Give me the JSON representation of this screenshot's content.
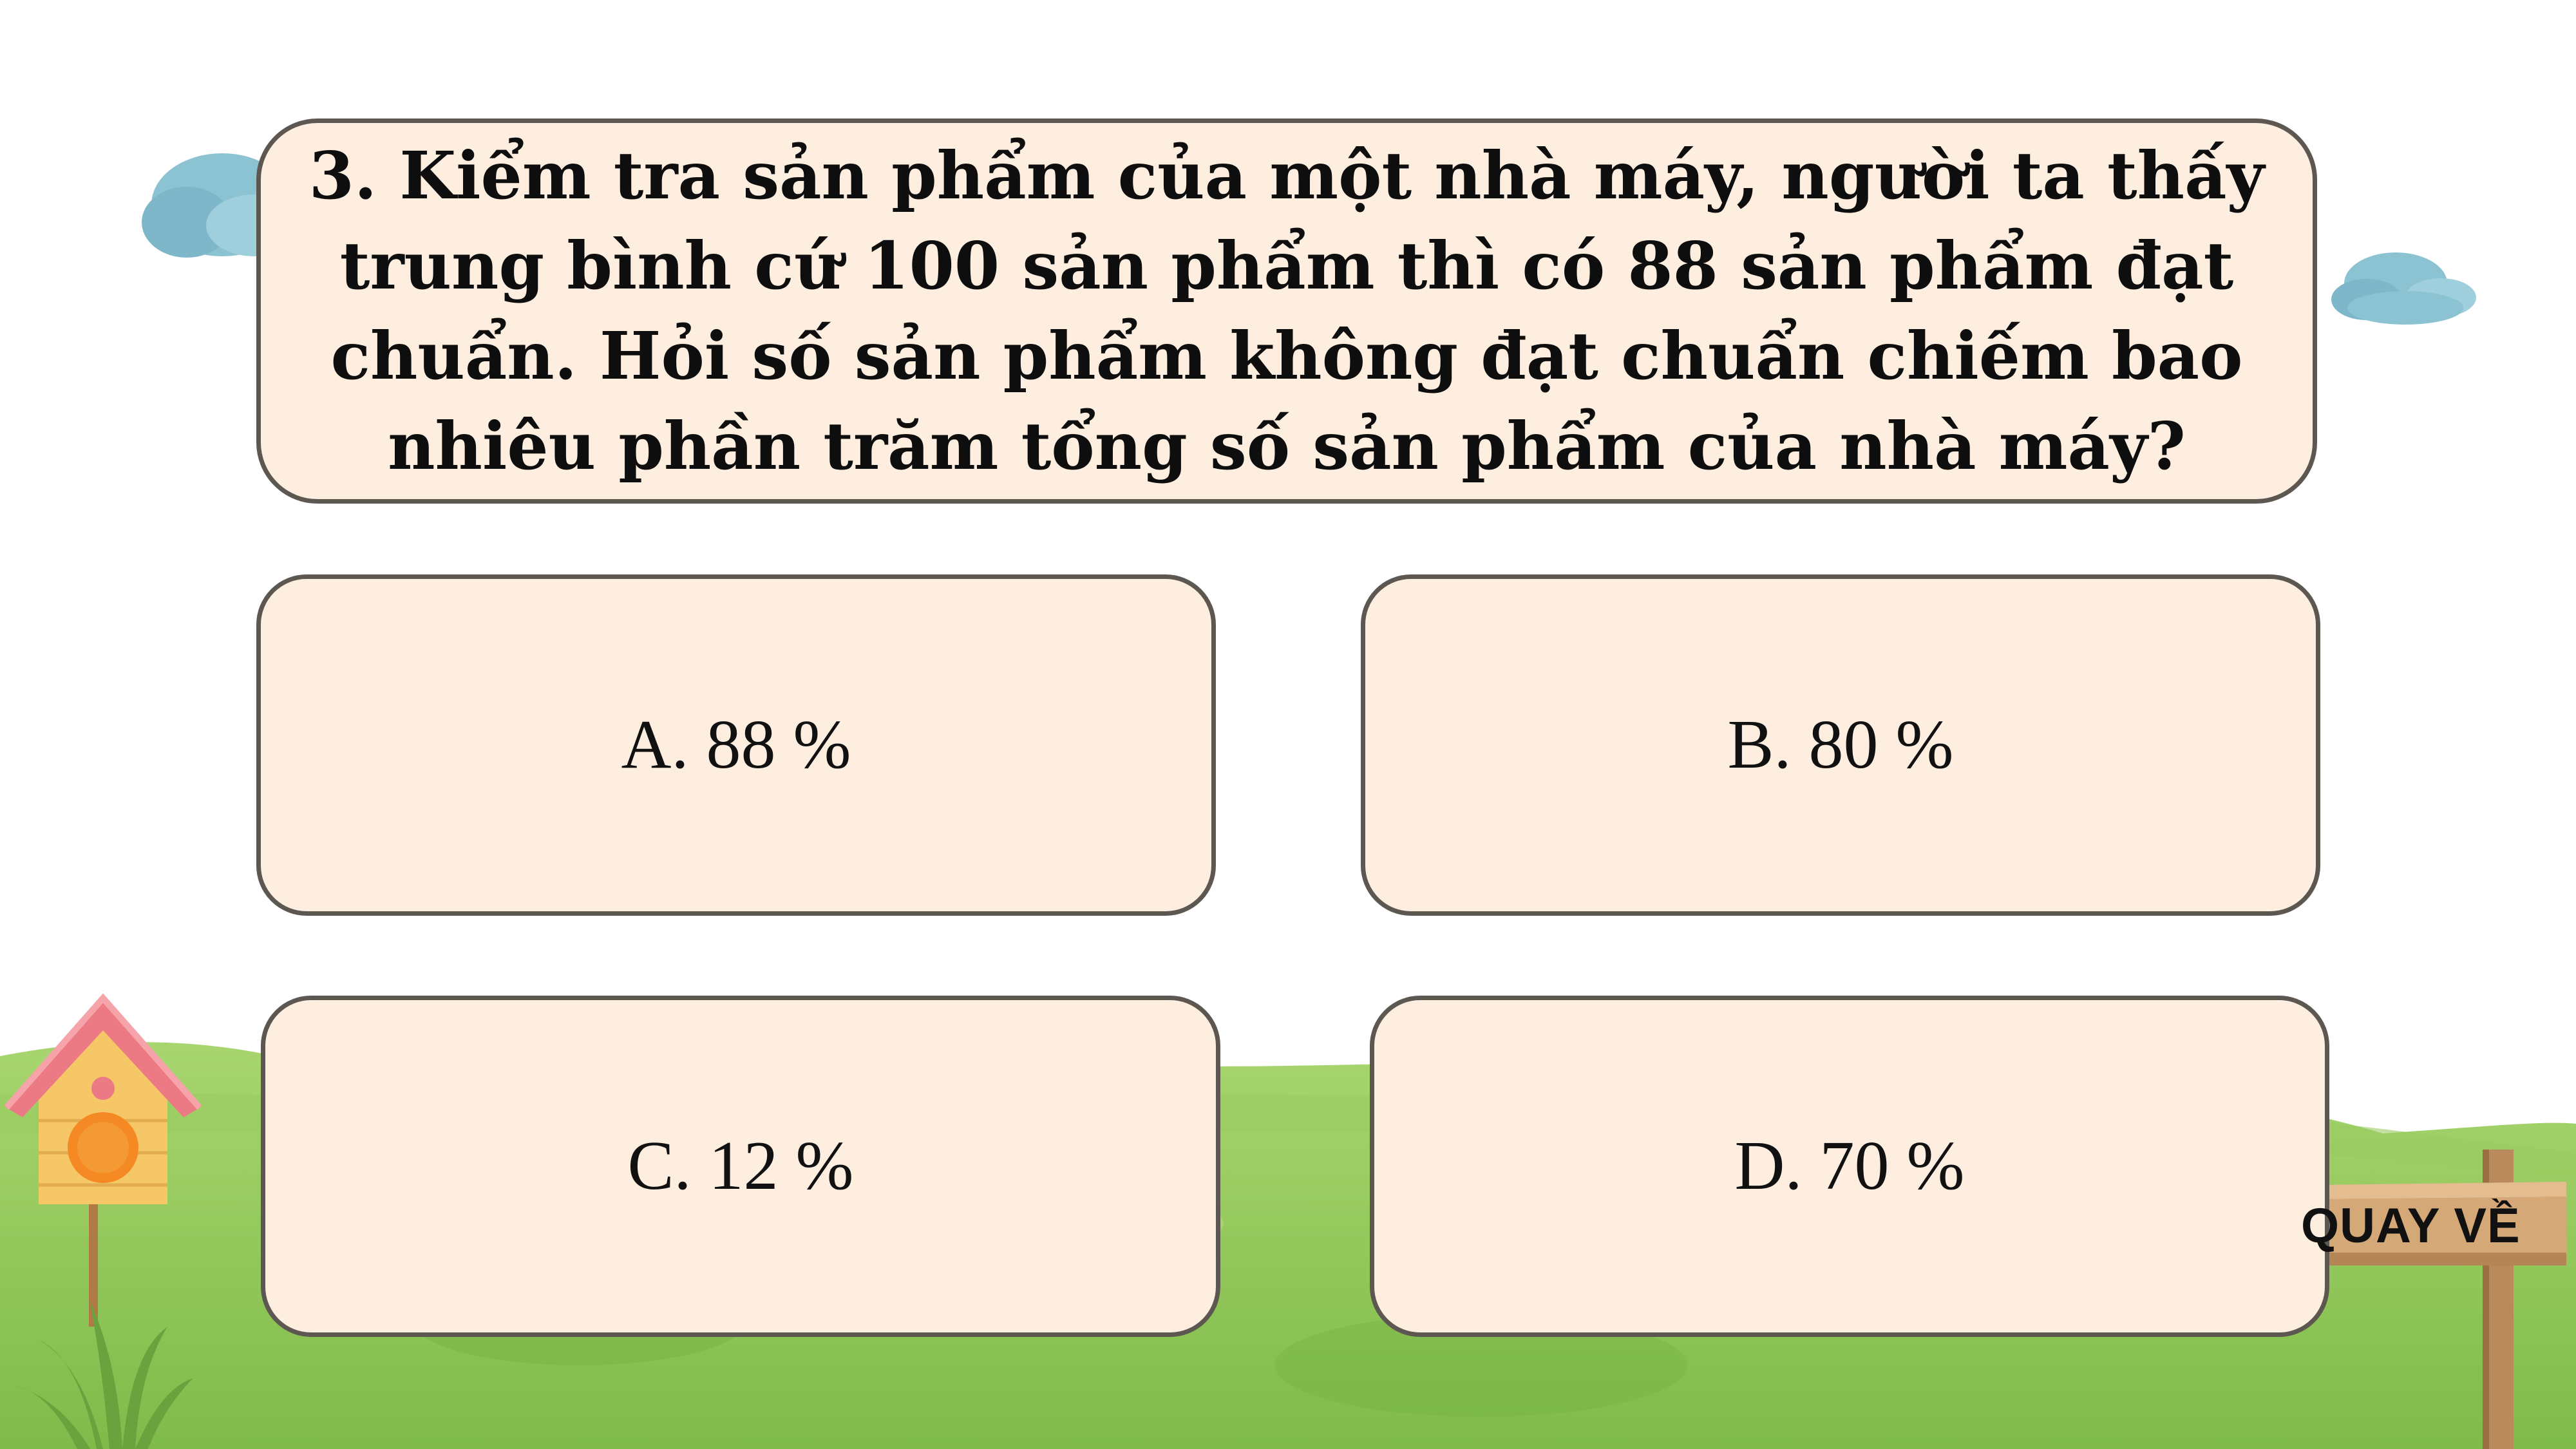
{
  "question": {
    "text": "3. Kiểm tra sản phẩm của một nhà máy, người ta thấy trung bình cứ 100 sản phẩm thì có 88 sản phẩm đạt chuẩn. Hỏi số sản phẩm không đạt chuẩn chiếm bao nhiêu phần trăm tổng số sản phẩm của nhà máy?"
  },
  "answers": [
    {
      "label": "A. 88 %"
    },
    {
      "label": "B. 80 %"
    },
    {
      "label": "C. 12 %"
    },
    {
      "label": "D. 70 %"
    }
  ],
  "back_button": {
    "label": "QUAY VỀ"
  },
  "colors": {
    "card_fill": "#fdeee0",
    "card_border": "#5d5752",
    "grass": "#8cc456",
    "cloud": "#8cc3d3"
  },
  "decorations": [
    "cloud-icon",
    "birdhouse-icon",
    "grass-hill",
    "wooden-signpost-icon"
  ]
}
